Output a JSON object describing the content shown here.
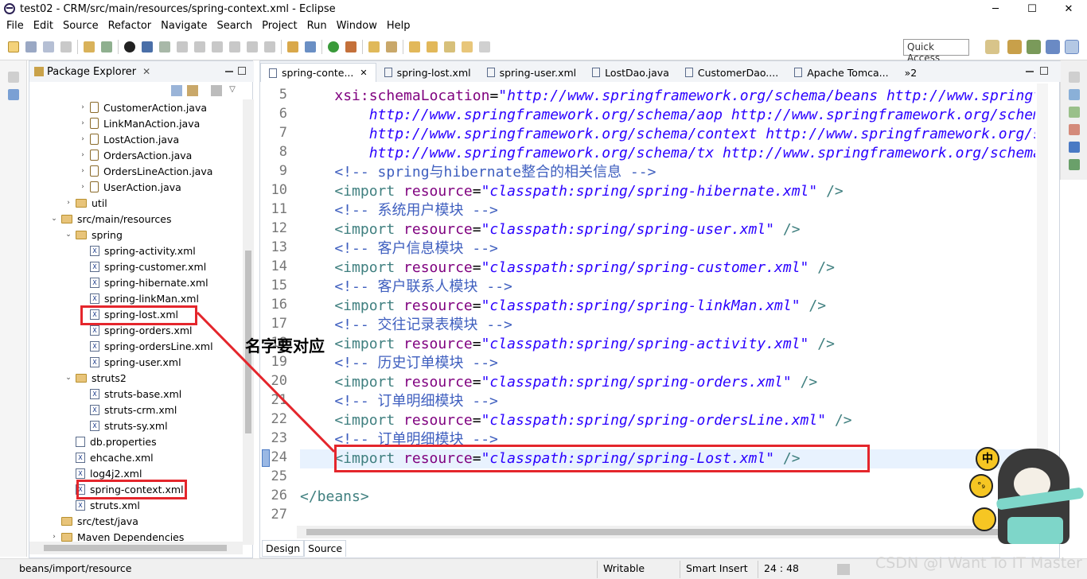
{
  "window": {
    "title": "test02 - CRM/src/main/resources/spring-context.xml - Eclipse",
    "minimize": "─",
    "maximize": "☐",
    "close": "✕"
  },
  "menu": [
    "File",
    "Edit",
    "Source",
    "Refactor",
    "Navigate",
    "Search",
    "Project",
    "Run",
    "Window",
    "Help"
  ],
  "toolbar": {
    "quick_access": "Quick Access"
  },
  "package_explorer": {
    "title": "Package Explorer",
    "close": "✕",
    "tree": [
      {
        "label": "CustomerAction.java",
        "level": 3,
        "type": "java",
        "arrow": "›"
      },
      {
        "label": "LinkManAction.java",
        "level": 3,
        "type": "java",
        "arrow": "›"
      },
      {
        "label": "LostAction.java",
        "level": 3,
        "type": "java",
        "arrow": "›"
      },
      {
        "label": "OrdersAction.java",
        "level": 3,
        "type": "java",
        "arrow": "›"
      },
      {
        "label": "OrdersLineAction.java",
        "level": 3,
        "type": "java",
        "arrow": "›"
      },
      {
        "label": "UserAction.java",
        "level": 3,
        "type": "java",
        "arrow": "›"
      },
      {
        "label": "util",
        "level": 2,
        "type": "package",
        "arrow": "›"
      },
      {
        "label": "src/main/resources",
        "level": 1,
        "type": "folder",
        "arrow": "⌄"
      },
      {
        "label": "spring",
        "level": 2,
        "type": "folder",
        "arrow": "⌄"
      },
      {
        "label": "spring-activity.xml",
        "level": 3,
        "type": "xml",
        "arrow": ""
      },
      {
        "label": "spring-customer.xml",
        "level": 3,
        "type": "xml",
        "arrow": ""
      },
      {
        "label": "spring-hibernate.xml",
        "level": 3,
        "type": "xml",
        "arrow": ""
      },
      {
        "label": "spring-linkMan.xml",
        "level": 3,
        "type": "xml",
        "arrow": ""
      },
      {
        "label": "spring-lost.xml",
        "level": 3,
        "type": "xml",
        "arrow": ""
      },
      {
        "label": "spring-orders.xml",
        "level": 3,
        "type": "xml",
        "arrow": ""
      },
      {
        "label": "spring-ordersLine.xml",
        "level": 3,
        "type": "xml",
        "arrow": ""
      },
      {
        "label": "spring-user.xml",
        "level": 3,
        "type": "xml",
        "arrow": ""
      },
      {
        "label": "struts2",
        "level": 2,
        "type": "folder",
        "arrow": "⌄"
      },
      {
        "label": "struts-base.xml",
        "level": 3,
        "type": "xml",
        "arrow": ""
      },
      {
        "label": "struts-crm.xml",
        "level": 3,
        "type": "xml",
        "arrow": ""
      },
      {
        "label": "struts-sy.xml",
        "level": 3,
        "type": "xml",
        "arrow": ""
      },
      {
        "label": "db.properties",
        "level": 2,
        "type": "file",
        "arrow": ""
      },
      {
        "label": "ehcache.xml",
        "level": 2,
        "type": "xml",
        "arrow": ""
      },
      {
        "label": "log4j2.xml",
        "level": 2,
        "type": "xml",
        "arrow": ""
      },
      {
        "label": "spring-context.xml",
        "level": 2,
        "type": "xml",
        "arrow": ""
      },
      {
        "label": "struts.xml",
        "level": 2,
        "type": "xml",
        "arrow": ""
      },
      {
        "label": "src/test/java",
        "level": 1,
        "type": "folder",
        "arrow": ""
      },
      {
        "label": "Maven Dependencies",
        "level": 1,
        "type": "folder",
        "arrow": "›"
      }
    ]
  },
  "editor": {
    "tabs": [
      {
        "label": "spring-conte...",
        "close": "✕",
        "active": true
      },
      {
        "label": "spring-lost.xml",
        "close": "",
        "active": false
      },
      {
        "label": "spring-user.xml",
        "close": "",
        "active": false
      },
      {
        "label": "LostDao.java",
        "close": "",
        "active": false
      },
      {
        "label": "CustomerDao....",
        "close": "",
        "active": false
      },
      {
        "label": "Apache Tomca...",
        "close": "",
        "active": false
      },
      {
        "label": "»2",
        "close": "",
        "active": false
      }
    ],
    "lines": [
      {
        "no": "5",
        "tokens": [
          {
            "t": "    ",
            "c": "pun"
          },
          {
            "t": "xsi:schemaLocation",
            "c": "attr"
          },
          {
            "t": "=",
            "c": "pun"
          },
          {
            "t": "\"http://www.springframework.org/schema/beans http://www.springframework.org/schema/beans/spring-beans.xsd",
            "c": "val"
          }
        ]
      },
      {
        "no": "6",
        "tokens": [
          {
            "t": "        http://www.springframework.org/schema/aop http://www.springframework.org/schema/aop/spring-aop.xsd",
            "c": "val"
          }
        ]
      },
      {
        "no": "7",
        "tokens": [
          {
            "t": "        http://www.springframework.org/schema/context http://www.springframework.org/schema/context/spring-context.xsd",
            "c": "val"
          }
        ]
      },
      {
        "no": "8",
        "tokens": [
          {
            "t": "        http://www.springframework.org/schema/tx http://www.springframework.org/schema/tx/spring-tx.xsd\">",
            "c": "val"
          }
        ]
      },
      {
        "no": "9",
        "tokens": [
          {
            "t": "    <!-- spring与hibernate整合的相关信息 -->",
            "c": "com"
          }
        ]
      },
      {
        "no": "10",
        "tokens": [
          {
            "t": "    <import ",
            "c": "tag"
          },
          {
            "t": "resource",
            "c": "attr"
          },
          {
            "t": "=",
            "c": "pun"
          },
          {
            "t": "\"classpath:spring/spring-hibernate.xml\"",
            "c": "val"
          },
          {
            "t": " />",
            "c": "tag"
          }
        ]
      },
      {
        "no": "11",
        "tokens": [
          {
            "t": "    <!-- 系统用户模块 -->",
            "c": "com"
          }
        ]
      },
      {
        "no": "12",
        "tokens": [
          {
            "t": "    <import ",
            "c": "tag"
          },
          {
            "t": "resource",
            "c": "attr"
          },
          {
            "t": "=",
            "c": "pun"
          },
          {
            "t": "\"classpath:spring/spring-user.xml\"",
            "c": "val"
          },
          {
            "t": " />",
            "c": "tag"
          }
        ]
      },
      {
        "no": "13",
        "tokens": [
          {
            "t": "    <!-- 客户信息模块 -->",
            "c": "com"
          }
        ]
      },
      {
        "no": "14",
        "tokens": [
          {
            "t": "    <import ",
            "c": "tag"
          },
          {
            "t": "resource",
            "c": "attr"
          },
          {
            "t": "=",
            "c": "pun"
          },
          {
            "t": "\"classpath:spring/spring-customer.xml\"",
            "c": "val"
          },
          {
            "t": " />",
            "c": "tag"
          }
        ]
      },
      {
        "no": "15",
        "tokens": [
          {
            "t": "    <!-- 客户联系人模块 -->",
            "c": "com"
          }
        ]
      },
      {
        "no": "16",
        "tokens": [
          {
            "t": "    <import ",
            "c": "tag"
          },
          {
            "t": "resource",
            "c": "attr"
          },
          {
            "t": "=",
            "c": "pun"
          },
          {
            "t": "\"classpath:spring/spring-linkMan.xml\"",
            "c": "val"
          },
          {
            "t": " />",
            "c": "tag"
          }
        ]
      },
      {
        "no": "17",
        "tokens": [
          {
            "t": "    <!-- 交往记录表模块 -->",
            "c": "com"
          }
        ]
      },
      {
        "no": "18",
        "tokens": [
          {
            "t": "    <import ",
            "c": "tag"
          },
          {
            "t": "resource",
            "c": "attr"
          },
          {
            "t": "=",
            "c": "pun"
          },
          {
            "t": "\"classpath:spring/spring-activity.xml\"",
            "c": "val"
          },
          {
            "t": " />",
            "c": "tag"
          }
        ]
      },
      {
        "no": "19",
        "tokens": [
          {
            "t": "    <!-- 历史订单模块 -->",
            "c": "com"
          }
        ]
      },
      {
        "no": "20",
        "tokens": [
          {
            "t": "    <import ",
            "c": "tag"
          },
          {
            "t": "resource",
            "c": "attr"
          },
          {
            "t": "=",
            "c": "pun"
          },
          {
            "t": "\"classpath:spring/spring-orders.xml\"",
            "c": "val"
          },
          {
            "t": " />",
            "c": "tag"
          }
        ]
      },
      {
        "no": "21",
        "tokens": [
          {
            "t": "    <!-- 订单明细模块 -->",
            "c": "com"
          }
        ]
      },
      {
        "no": "22",
        "tokens": [
          {
            "t": "    <import ",
            "c": "tag"
          },
          {
            "t": "resource",
            "c": "attr"
          },
          {
            "t": "=",
            "c": "pun"
          },
          {
            "t": "\"classpath:spring/spring-ordersLine.xml\"",
            "c": "val"
          },
          {
            "t": " />",
            "c": "tag"
          }
        ]
      },
      {
        "no": "23",
        "tokens": [
          {
            "t": "    <!-- 订单明细模块 -->",
            "c": "com"
          }
        ]
      },
      {
        "no": "24",
        "tokens": [
          {
            "t": "    <import ",
            "c": "tag"
          },
          {
            "t": "resource",
            "c": "attr"
          },
          {
            "t": "=",
            "c": "pun"
          },
          {
            "t": "\"classpath:spring/spring-Lost.xml\"",
            "c": "val"
          },
          {
            "t": " />",
            "c": "tag"
          }
        ]
      },
      {
        "no": "25",
        "tokens": []
      },
      {
        "no": "26",
        "tokens": [
          {
            "t": "</beans>",
            "c": "tag"
          }
        ]
      },
      {
        "no": "27",
        "tokens": []
      }
    ],
    "bottom_tabs": [
      "Design",
      "Source"
    ]
  },
  "status": {
    "path": "beans/import/resource",
    "writable": "Writable",
    "insert_mode": "Smart Insert",
    "position": "24 : 48"
  },
  "annotation": "名字要对应",
  "watermark": "CSDN @I Want To IT Master",
  "colors": {
    "highlight": "#e4262c",
    "current_line": "#e8f2fe"
  }
}
